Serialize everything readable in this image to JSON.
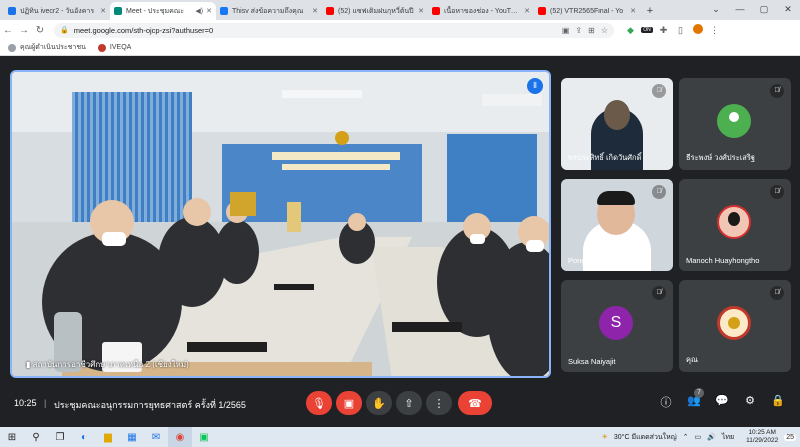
{
  "browser": {
    "tabs": [
      {
        "title": "ปฏิทิน ivecr2 - วันอังคาร",
        "fav": "calendar-icon",
        "color": "#1a73e8",
        "active": false
      },
      {
        "title": "Meet - ประชุมคณะ",
        "fav": "meet-icon",
        "color": "#00897b",
        "active": true
      },
      {
        "title": "Thisv ส่งข้อความถึงคุณ",
        "fav": "facebook-icon",
        "color": "#1877f2",
        "active": false
      },
      {
        "title": "(52) แซฟเติมฝนกุหวี่ต้นปี",
        "fav": "youtube-icon",
        "color": "#ff0000",
        "active": false
      },
      {
        "title": "เนื้อหาของช่อง - YouTube",
        "fav": "youtube-icon",
        "color": "#ff0000",
        "active": false
      },
      {
        "title": "(52) VTR2565Final - Yo",
        "fav": "youtube-icon",
        "color": "#ff0000",
        "active": false
      }
    ],
    "url": "meet.google.com/sth-ojcp-zsi?authuser=0",
    "bookmarks": [
      {
        "label": "คุณผู้ดำเนินประชาชน",
        "color": "#9aa0a6"
      },
      {
        "label": "IVEQA",
        "color": "#c0392b"
      }
    ]
  },
  "meeting": {
    "main_speaker": "สถาบันการอาชีวศึกษาภาคเหนือ 2 (เชียงใหม่)",
    "room_sign": "สถาบันการอาชีวศึกษาภาคเหนือ ๒",
    "time": "10:25",
    "separator": "|",
    "title": "ประชุมคณะอนุกรรมการยุทธศาสตร์ ครั้งที่ 1/2565",
    "participant_count": "7",
    "participants": [
      {
        "name": "พรประสิทธิ์ เกิดวันศักดิ์",
        "kind": "video",
        "color": "#6b5a4a"
      },
      {
        "name": "ธีระพงษ์ วงศ์ประเสริฐ",
        "kind": "avatar",
        "color": "#4caf50"
      },
      {
        "name": "Pongsatorn Chaichan",
        "kind": "video",
        "color": "#cfd6dc"
      },
      {
        "name": "Manoch Huayhongtho",
        "kind": "photo",
        "color": "#d32f2f"
      },
      {
        "name": "Suksa Naiyajit",
        "kind": "letter",
        "letter": "S",
        "color": "#8e24aa"
      },
      {
        "name": "คุณ",
        "kind": "seal",
        "color": "#c0392b"
      }
    ]
  },
  "taskbar": {
    "weather": "30°C มีแดดส่วนใหญ่",
    "lang": "ไทย",
    "clock_time": "10:25 AM",
    "clock_date": "11/29/2022",
    "notif_count": "25"
  }
}
